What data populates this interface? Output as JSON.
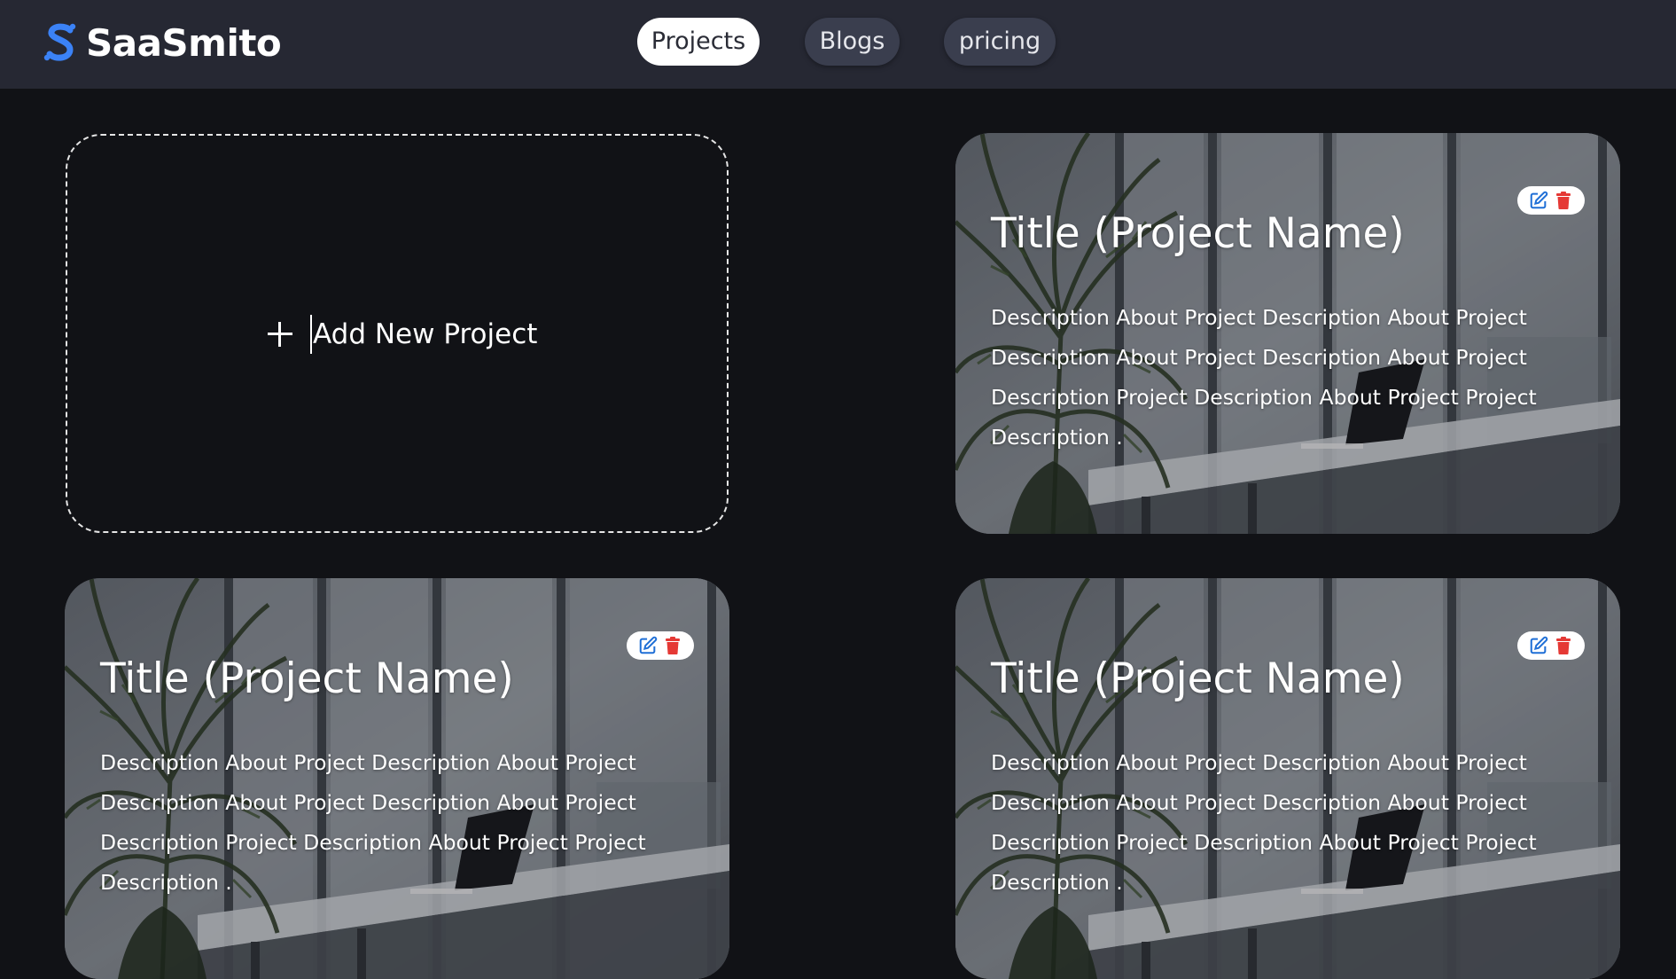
{
  "brand": {
    "name": "SaaSmito",
    "logo_icon": "s-logo-icon",
    "accent_color": "#3b82f6"
  },
  "nav": {
    "items": [
      {
        "label": "Projects",
        "active": true
      },
      {
        "label": "Blogs",
        "active": false
      },
      {
        "label": "pricing",
        "active": false
      }
    ]
  },
  "add_project": {
    "label": "Add New Project",
    "icon": "plus-icon"
  },
  "projects": [
    {
      "title": "Title (Project Name)",
      "description": "Description About Project Description About Project Description About Project Description About Project Description Project Description About Project Project Description ."
    },
    {
      "title": "Title (Project Name)",
      "description": "Description About Project Description About Project Description About Project Description About Project Description Project Description About Project Project Description ."
    },
    {
      "title": "Title (Project Name)",
      "description": "Description About Project Description About Project Description About Project Description About Project Description Project Description About Project Project Description ."
    }
  ],
  "card_actions": {
    "edit_icon": "edit-icon",
    "delete_icon": "trash-icon",
    "edit_color": "#1f6fd6",
    "delete_color": "#e53935"
  }
}
